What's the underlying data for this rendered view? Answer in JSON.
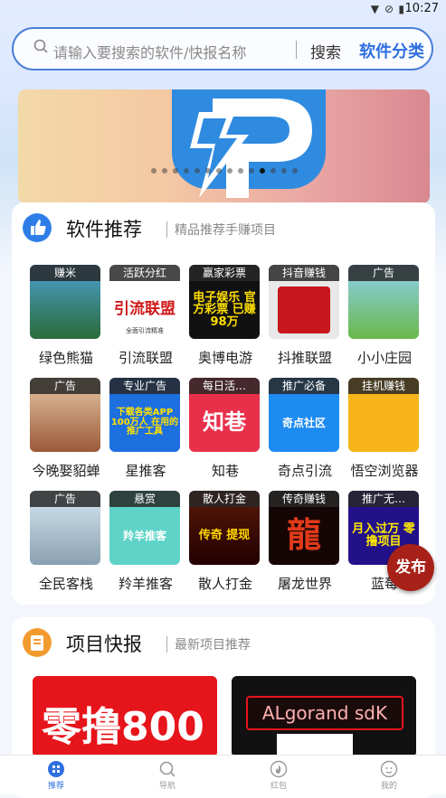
{
  "status": {
    "time": "10:27"
  },
  "search": {
    "placeholder": "请输入要搜索的软件/快报名称",
    "search_label": "搜索",
    "category_label": "软件分类"
  },
  "banner": {
    "slide_count": 14,
    "active_slide": 10
  },
  "software": {
    "title": "软件推荐",
    "subtitle": "精品推荐手赚项目",
    "apps": [
      {
        "name": "绿色熊猫",
        "tag": "赚米"
      },
      {
        "name": "引流联盟",
        "tag": "活跃分红",
        "art": "引流联盟",
        "art_sub": "全面引流精准"
      },
      {
        "name": "奥博电游",
        "tag": "赢家彩票",
        "art": "电子娱乐 官方彩票 已赚98万"
      },
      {
        "name": "抖推联盟",
        "tag": "抖音赚钱"
      },
      {
        "name": "小小庄园",
        "tag": "广告"
      },
      {
        "name": "今晚娶貂蝉",
        "tag": "广告"
      },
      {
        "name": "星推客",
        "tag": "专业广告",
        "art": "下载各类APP 100万人 在用的推广工具"
      },
      {
        "name": "知巷",
        "tag": "每日活…",
        "art": "知巷"
      },
      {
        "name": "奇点引流",
        "tag": "推广必备",
        "art": "奇点社区"
      },
      {
        "name": "悟空浏览器",
        "tag": "挂机赚钱"
      },
      {
        "name": "全民客栈",
        "tag": "广告"
      },
      {
        "name": "羚羊推客",
        "tag": "悬赏",
        "art": "羚羊推客"
      },
      {
        "name": "散人打金",
        "tag": "散人打金",
        "art": "传奇 提现"
      },
      {
        "name": "屠龙世界",
        "tag": "传奇赚钱",
        "art": "龍"
      },
      {
        "name": "蓝莓",
        "tag": "推广无…",
        "art": "月入过万 零撸项目"
      }
    ]
  },
  "publish": {
    "label": "发布"
  },
  "news": {
    "title": "项目快报",
    "subtitle": "最新项目推荐",
    "items": [
      {
        "text": "零撸800"
      },
      {
        "text": "ALgorand sdK"
      }
    ]
  },
  "tabs": [
    {
      "label": "推荐",
      "icon": "grid-icon",
      "active": true
    },
    {
      "label": "导航",
      "icon": "search-icon",
      "active": false
    },
    {
      "label": "红包",
      "icon": "fire-icon",
      "active": false
    },
    {
      "label": "我的",
      "icon": "face-icon",
      "active": false
    }
  ],
  "colors": {
    "accent": "#2f6fe0",
    "publish": "#a82118"
  }
}
